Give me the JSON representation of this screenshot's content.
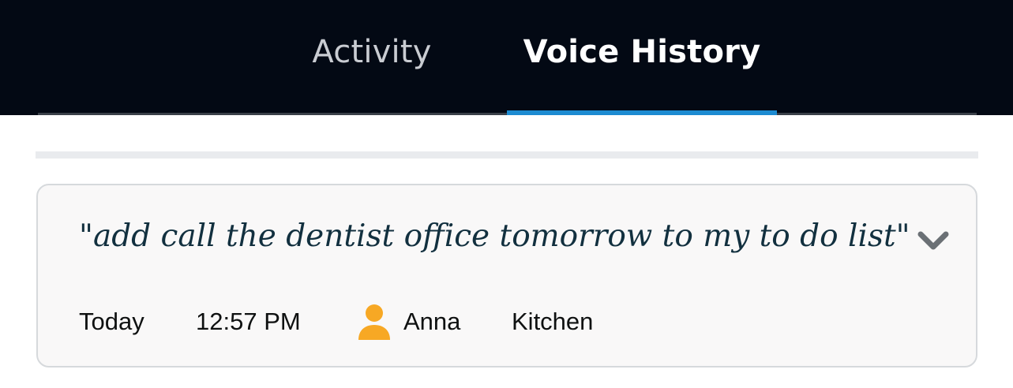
{
  "tabs": [
    {
      "label": "Activity",
      "selected": false
    },
    {
      "label": "Voice History",
      "selected": true
    }
  ],
  "colors": {
    "topbar_bg": "#030914",
    "tab_indicator": "#1d8bd1",
    "user_icon": "#f7a824",
    "utterance_text": "#12303f"
  },
  "entry": {
    "utterance": "\"add call the dentist office tomorrow to my to do list\"",
    "expand_icon": "chevron-down-icon",
    "day": "Today",
    "time": "12:57 PM",
    "user_icon": "person-icon",
    "user": "Anna",
    "device": "Kitchen"
  }
}
